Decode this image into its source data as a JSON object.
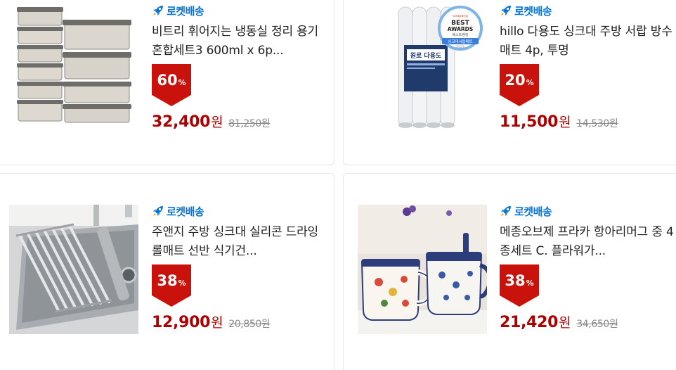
{
  "products": [
    {
      "badge": "로켓배송",
      "title": "비트리 휘어지는 냉동실 정리 용기 혼합세트3 600ml x 6p...",
      "discount": "60",
      "discount_unit": "%",
      "price": "32,400",
      "price_unit": "원",
      "original_price": "81,250원"
    },
    {
      "badge": "로켓배송",
      "title": "hillo 다용도 싱크대 주방 서랍 방수 매트 4p, 투명",
      "discount": "20",
      "discount_unit": "%",
      "price": "11,500",
      "price_unit": "원",
      "original_price": "14,530원",
      "award": {
        "brand": "coupang",
        "line1": "BEST",
        "line2": "AWARDS",
        "sub": "베스트랭킹",
        "ribbon": "싱크대서랍매트",
        "year": "2023"
      },
      "package_label": "원로 다용도"
    },
    {
      "badge": "로켓배송",
      "title": "주앤지 주방 싱크대 실리콘 드라잉 롤매트 선반 식기건...",
      "discount": "38",
      "discount_unit": "%",
      "price": "12,900",
      "price_unit": "원",
      "original_price": "20,850원"
    },
    {
      "badge": "로켓배송",
      "title": "메종오브제 프라카 항아리머그 중 4종세트 C. 플라워가...",
      "discount": "38",
      "discount_unit": "%",
      "price": "21,420",
      "price_unit": "원",
      "original_price": "34,650원"
    }
  ],
  "colors": {
    "rocket": "#0a74d4",
    "discount_bg": "#c8120b",
    "price": "#ae0000"
  }
}
